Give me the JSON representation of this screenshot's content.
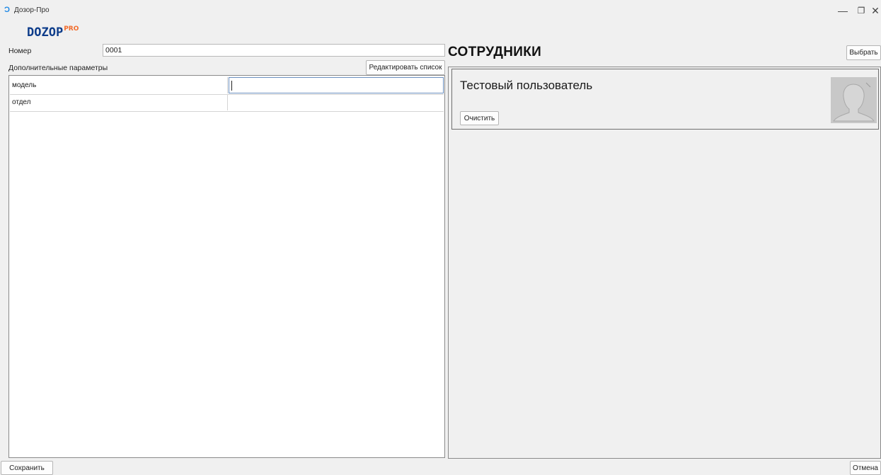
{
  "window": {
    "title": "Дозор-Про",
    "minimize": "—",
    "maximize": "❐",
    "close": "✕"
  },
  "logo": {
    "main": "DOZOP",
    "pro": "PRO"
  },
  "form": {
    "number_label": "Номер",
    "number_value": "0001",
    "extra_params_label": "Дополнительные параметры",
    "edit_list_button": "Редактировать список",
    "params": [
      {
        "key": "модель",
        "value": ""
      },
      {
        "key": "отдел",
        "value": ""
      }
    ]
  },
  "employees": {
    "heading": "СОТРУДНИКИ",
    "select_button": "Выбрать",
    "card": {
      "name": "Тестовый пользователь",
      "clear_button": "Очистить"
    }
  },
  "footer": {
    "save_button": "Сохранить",
    "cancel_button": "Отмена"
  },
  "colors": {
    "accent": "#0d3c8a",
    "accent_pro": "#f26b2a",
    "background": "#f0f0f0"
  }
}
